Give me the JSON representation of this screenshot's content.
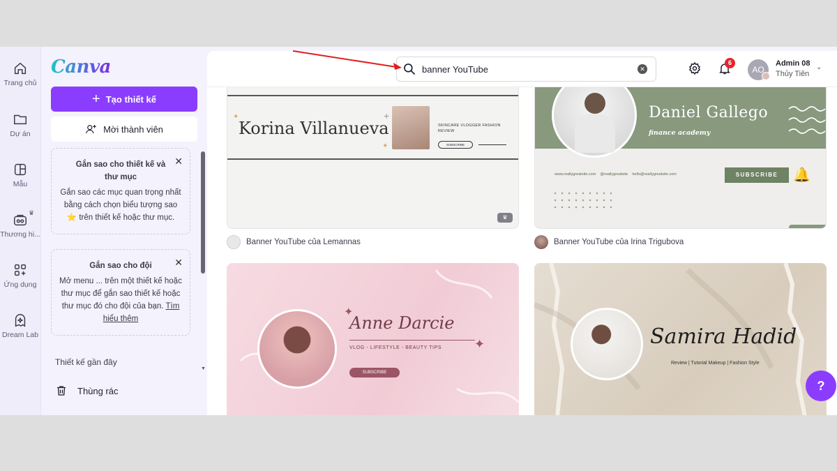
{
  "rail": {
    "items": [
      {
        "label": "Trang chủ",
        "icon": "home-icon"
      },
      {
        "label": "Dự án",
        "icon": "folder-icon"
      },
      {
        "label": "Mẫu",
        "icon": "template-icon"
      },
      {
        "label": "Thương hi...",
        "icon": "brand-icon"
      },
      {
        "label": "Ứng dụng",
        "icon": "apps-icon"
      },
      {
        "label": "Dream Lab",
        "icon": "dream-lab-icon"
      }
    ]
  },
  "panel": {
    "logo": "Canva",
    "create_label": "Tạo thiết kế",
    "invite_label": "Mời thành viên",
    "card1": {
      "title": "Gắn sao cho thiết kế và thư mục",
      "body": "Gắn sao các mục quan trọng nhất bằng cách chọn biểu tượng sao ⭐ trên thiết kế hoặc thư mục."
    },
    "card2": {
      "title": "Gắn sao cho đội",
      "body": "Mở menu ... trên một thiết kế hoặc thư mục để gắn sao thiết kế hoặc thư mục đó cho đội của bạn.",
      "link": "Tìm hiểu thêm"
    },
    "recent_label": "Thiết kế gần đây",
    "trash_label": "Thùng rác"
  },
  "topbar": {
    "search_value": "banner YouTube",
    "notifications_count": "6",
    "avatar_initials": "AO",
    "user_name": "Admin 08",
    "team_name": "Thủy Tiên"
  },
  "results": [
    {
      "caption": "Banner YouTube của Lemannas",
      "name_text": "Korina Villanueva",
      "tags": "SKINCARE   VLOGGER   FASHION   REVIEW",
      "button": "SUBSCRIBE"
    },
    {
      "caption": "Banner YouTube của Irina Trigubova",
      "name_text": "Daniel Gallego",
      "subtitle": "finance academy",
      "links": "www.reallygreatsite.com    @reallygreatsite    hello@reallygreatsite.com",
      "button": "SUBSCRIBE"
    },
    {
      "name_text": "Anne Darcie",
      "subtitle": "VLOG - LIFESTYLE - BEAUTY TIPS",
      "button": "SUBSCRIBE"
    },
    {
      "name_text": "Samira Hadid",
      "subtitle": "Review | Tutorial Makeup | Fashion Style"
    }
  ],
  "help_label": "?"
}
